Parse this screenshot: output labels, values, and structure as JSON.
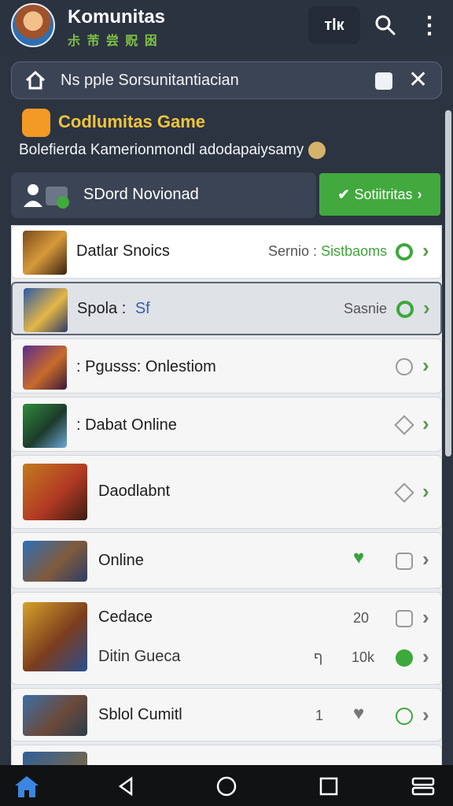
{
  "header": {
    "title": "Komunitas",
    "subtitle": "尗 芾 尝 贶 囦",
    "sort_label": "тlк",
    "icons": [
      "avatar",
      "sort-icon",
      "search-icon",
      "more-vert-icon"
    ]
  },
  "notice": {
    "text": "Ns pple Sorsunitantiacian",
    "icons": [
      "home-icon",
      "pin-icon",
      "close-icon"
    ]
  },
  "community": {
    "title": "Codlumitas Game",
    "description": "Bolefierda Kamerionmondl adodapaiysamy",
    "member_label": "SDord Novionad",
    "join_label": "Sotiitritas"
  },
  "rows": [
    {
      "title": "Datlar Snoics",
      "meta": "Sernio :",
      "meta_accent": "Sistbaoms",
      "state": "green-ring"
    },
    {
      "title": "Spola :",
      "title_accent": "Sf",
      "meta": "Sasnie",
      "state": "green-ring"
    },
    {
      "title": ": Pgusss: Onlestiom",
      "state": "ring"
    },
    {
      "title": ": Dabat Online",
      "state": "diamond"
    },
    {
      "title": "Daodlabnt",
      "state": "diamond"
    },
    {
      "title": "Online",
      "state": "square",
      "heart": true
    },
    {
      "title": "Cedace",
      "meta": "20",
      "state": "square",
      "sub_title": "Ditin Gueca",
      "sub_meta_a": "ף",
      "sub_meta_b": "10k"
    },
    {
      "title": "Sblol Cumitl",
      "meta": "1",
      "state": "ring-green",
      "heart_grey": true
    }
  ],
  "nav": [
    "home-icon",
    "back-icon",
    "home-circle-icon",
    "recents-icon",
    "menu-icon"
  ],
  "colors": {
    "accent_green": "#42a93e",
    "topbar": "#2b3341",
    "title_yellow": "#f0c43a"
  }
}
